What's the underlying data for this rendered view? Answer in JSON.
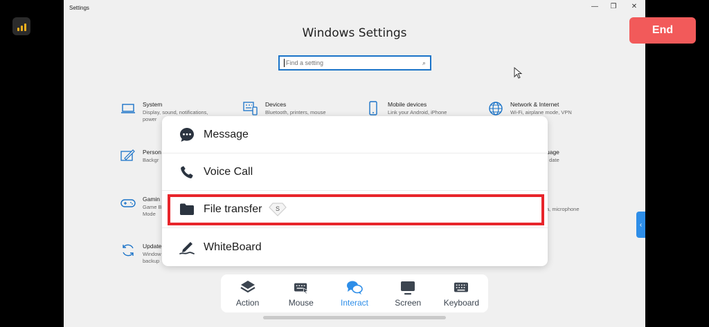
{
  "window": {
    "title": "Settings",
    "minimize": "—",
    "restore": "❐",
    "close": "✕",
    "heading": "Windows Settings"
  },
  "search": {
    "placeholder": "Find a setting"
  },
  "tiles": [
    {
      "title": "System",
      "desc": "Display, sound, notifications, power",
      "icon": "laptop-icon"
    },
    {
      "title": "Devices",
      "desc": "Bluetooth, printers, mouse",
      "icon": "keyboard-icon"
    },
    {
      "title": "Mobile devices",
      "desc": "Link your Android, iPhone",
      "icon": "phone-icon"
    },
    {
      "title": "Network & Internet",
      "desc": "Wi-Fi, airplane mode, VPN",
      "icon": "globe-icon"
    },
    {
      "title": "Person",
      "desc": "Backgr",
      "icon": "pen-icon"
    },
    {
      "title": "uage",
      "desc": ", date",
      "icon": ""
    },
    {
      "title": "Gamin",
      "desc": "Game B Mode",
      "icon": "gamepad-icon"
    },
    {
      "title": "",
      "desc": "a, microphone",
      "icon": ""
    },
    {
      "title": "Update",
      "desc": "Window backup",
      "icon": "sync-icon"
    }
  ],
  "end_button": {
    "label": "End",
    "color": "#f25a5a"
  },
  "popup": {
    "items": [
      {
        "label": "Message",
        "icon": "chat-bubble-icon"
      },
      {
        "label": "Voice Call",
        "icon": "phone-call-icon"
      },
      {
        "label": "File transfer",
        "icon": "folder-icon",
        "badge": "S"
      },
      {
        "label": "WhiteBoard",
        "icon": "whiteboard-pen-icon"
      }
    ]
  },
  "toolbar": {
    "items": [
      {
        "label": "Action",
        "icon": "layers-icon"
      },
      {
        "label": "Mouse",
        "icon": "mouse-keyboard-icon"
      },
      {
        "label": "Interact",
        "icon": "interact-chat-icon",
        "active": true
      },
      {
        "label": "Screen",
        "icon": "monitor-icon"
      },
      {
        "label": "Keyboard",
        "icon": "keyboard-icon"
      }
    ]
  },
  "colors": {
    "accent": "#2e8ee8",
    "highlight": "#e8252b",
    "windows_blue": "#1a73c8"
  }
}
